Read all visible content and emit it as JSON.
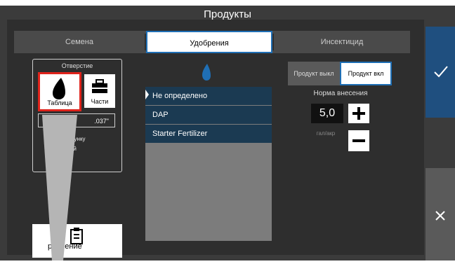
{
  "window": {
    "title": "Продукты"
  },
  "tabs": [
    {
      "label": "Семена"
    },
    {
      "label": "Удобрения"
    },
    {
      "label": "Инсектицид"
    }
  ],
  "orifice_panel": {
    "title": "Отверстие",
    "table_button": "Таблица",
    "parts_button": "Части",
    "size_value": ".037\"",
    "info_line1": "ть форсунку",
    "info_line2": "е сетчатый",
    "info_line3": "меш."
  },
  "product_list": {
    "items": [
      "Не определено",
      "DAP",
      "Starter Fertilizer"
    ]
  },
  "toggle": {
    "off_label": "Продукт выкл",
    "on_label": "Продукт вкл"
  },
  "rate": {
    "title": "Норма внесения",
    "value": "5,0",
    "unit": "гал/акр"
  },
  "bottom_button": {
    "label": "равление"
  },
  "colors": {
    "accent": "#1f6fb5",
    "highlight": "#e0231b",
    "list_bg": "#1b3a52"
  }
}
